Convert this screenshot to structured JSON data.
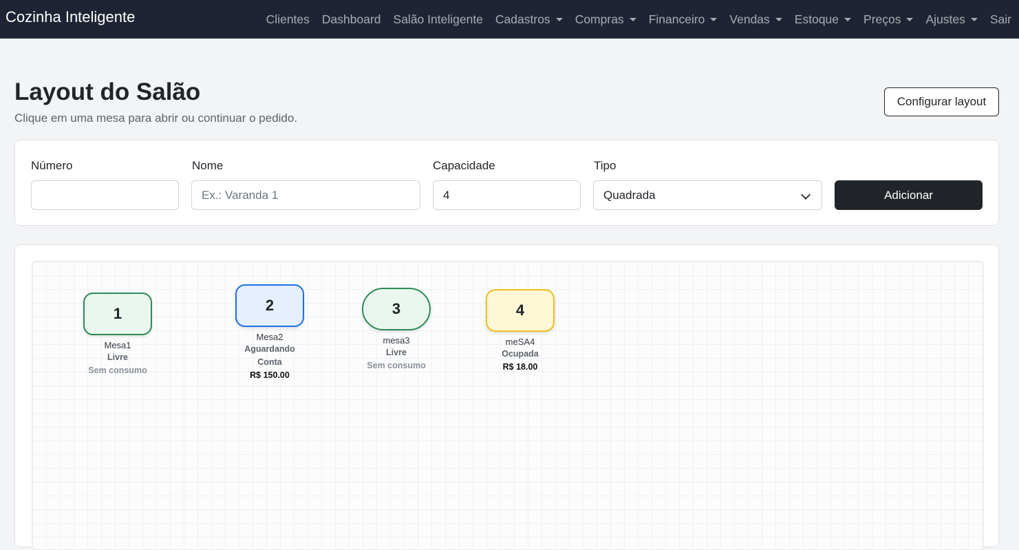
{
  "navbar": {
    "brand": "Cozinha Inteligente",
    "items": [
      {
        "label": "Clientes",
        "dropdown": false
      },
      {
        "label": "Dashboard",
        "dropdown": false
      },
      {
        "label": "Salão Inteligente",
        "dropdown": false
      },
      {
        "label": "Cadastros",
        "dropdown": true
      },
      {
        "label": "Compras",
        "dropdown": true
      },
      {
        "label": "Financeiro",
        "dropdown": true
      },
      {
        "label": "Vendas",
        "dropdown": true
      },
      {
        "label": "Estoque",
        "dropdown": true
      },
      {
        "label": "Preços",
        "dropdown": true
      },
      {
        "label": "Ajustes",
        "dropdown": true
      },
      {
        "label": "Sair",
        "dropdown": false
      }
    ]
  },
  "header": {
    "title": "Layout do Salão",
    "subtitle": "Clique em uma mesa para abrir ou continuar o pedido.",
    "config_button": "Configurar layout"
  },
  "form": {
    "numero_label": "Número",
    "numero_value": "",
    "nome_label": "Nome",
    "nome_placeholder": "Ex.: Varanda 1",
    "capacidade_label": "Capacidade",
    "capacidade_value": "4",
    "tipo_label": "Tipo",
    "tipo_value": "Quadrada",
    "add_button": "Adicionar"
  },
  "tables": [
    {
      "number": "1",
      "name": "Mesa1",
      "status": "Livre",
      "amount": "Sem consumo",
      "shape": "square",
      "border": "#2e8b57",
      "fill": "#eaf6ee"
    },
    {
      "number": "2",
      "name": "Mesa2",
      "status": "Aguardando Conta",
      "amount": "R$ 150.00",
      "shape": "square",
      "border": "#1f6fe0",
      "fill": "#e6effd"
    },
    {
      "number": "3",
      "name": "mesa3",
      "status": "Livre",
      "amount": "Sem consumo",
      "shape": "round",
      "border": "#2e8b57",
      "fill": "#eaf6ee"
    },
    {
      "number": "4",
      "name": "meSA4",
      "status": "Ocupada",
      "amount": "R$ 18.00",
      "shape": "square",
      "border": "#f0c020",
      "fill": "#fff7d6"
    }
  ]
}
